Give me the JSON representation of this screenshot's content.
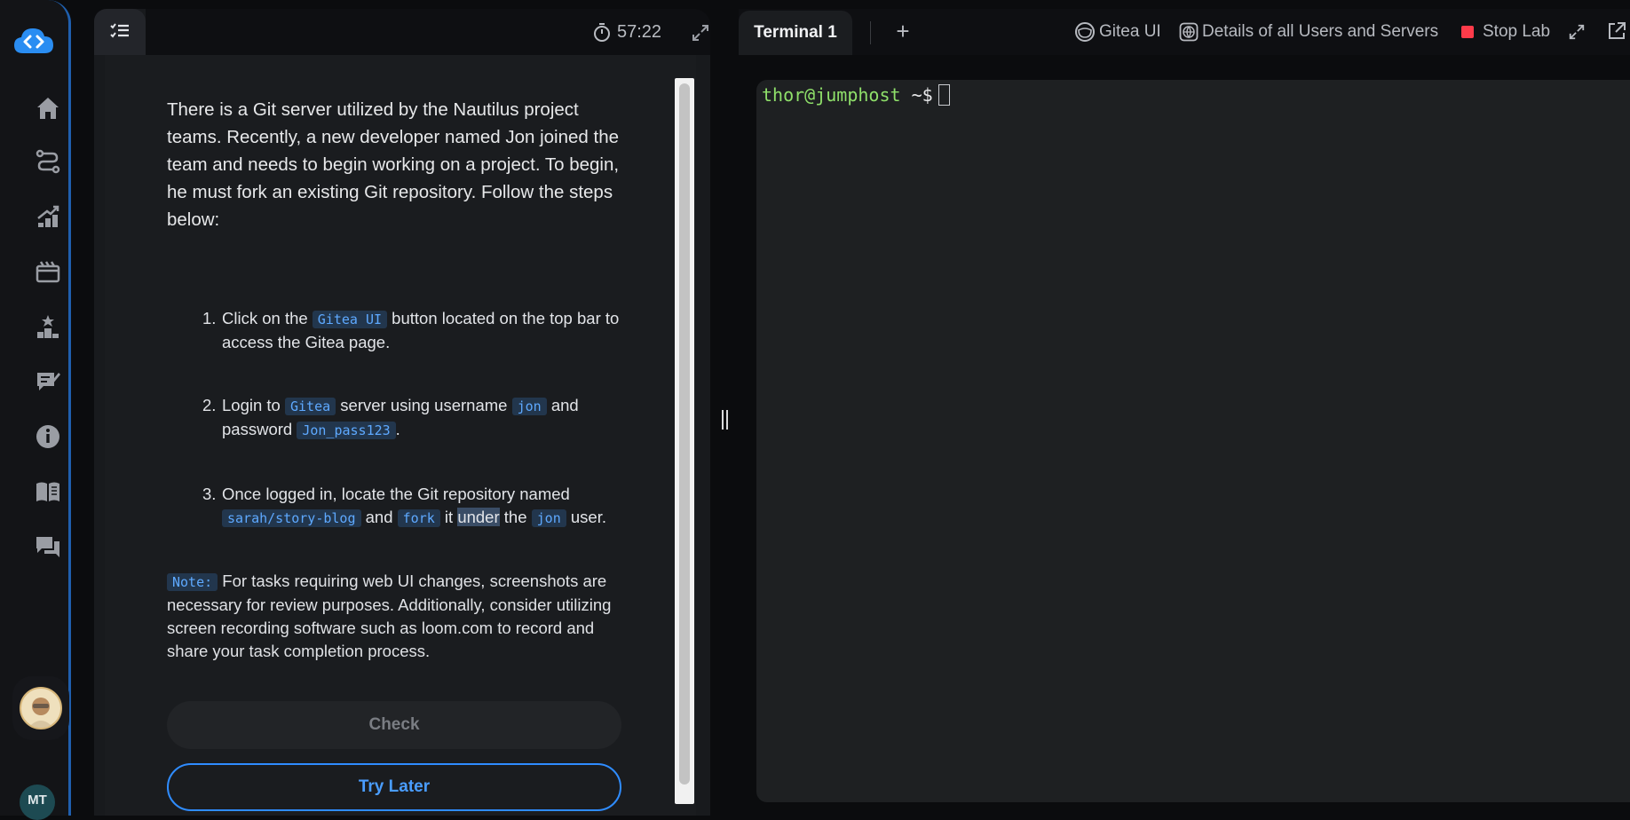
{
  "nav": {
    "items": [
      "home",
      "paths",
      "progress",
      "labs",
      "leaderboard",
      "feedback",
      "info",
      "docs",
      "chat"
    ],
    "user_initials": "MT"
  },
  "task": {
    "timer": "57:22",
    "intro": "There is a Git server utilized by the Nautilus project teams. Recently, a new developer named Jon joined the team and needs to begin working on a project. To begin, he must fork an existing Git repository. Follow the steps below:",
    "steps": [
      {
        "num": "1.",
        "parts": [
          "Click on the ",
          "Gitea UI",
          " button located on the top bar to access the Gitea page."
        ]
      },
      {
        "num": "2.",
        "parts": [
          "Login to ",
          "Gitea",
          " server using username ",
          "jon",
          " and password ",
          "Jon_pass123",
          "."
        ]
      },
      {
        "num": "3.",
        "parts": [
          "Once logged in, locate the Git repository named ",
          "sarah/story-blog",
          " and ",
          "fork",
          " it ",
          "under",
          " the ",
          "jon",
          " user."
        ]
      }
    ],
    "note_label": "Note:",
    "note_text": " For tasks requiring web UI changes, screenshots are necessary for review purposes. Additionally, consider utilizing screen recording software such as loom.com to record and share your task completion process.",
    "check_label": "Check",
    "try_later_label": "Try Later"
  },
  "terminal": {
    "tab_label": "Terminal 1",
    "add_tab": "+",
    "prompt_user": "thor@jumphost",
    "prompt_symbol": " ~$"
  },
  "toolbar": {
    "gitea_label": "Gitea UI",
    "details_label": "Details of all Users and Servers",
    "stop_label": "Stop Lab"
  },
  "colors": {
    "accent": "#2f8cff",
    "code": "#5ea9ff",
    "prompt_user": "#8fe06a",
    "stop": "#ff3b4a"
  }
}
